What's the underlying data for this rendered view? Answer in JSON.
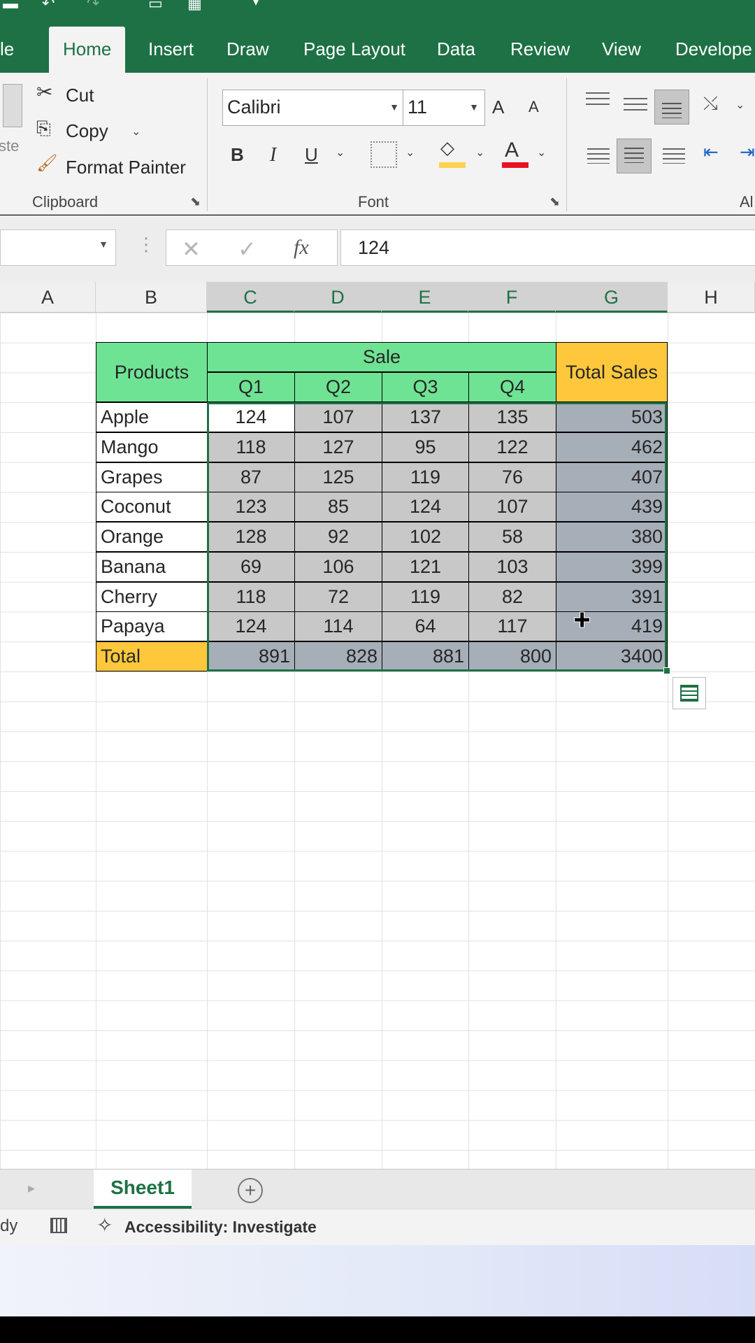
{
  "tabs": [
    "le",
    "Home",
    "Insert",
    "Draw",
    "Page Layout",
    "Data",
    "Review",
    "View",
    "Develope"
  ],
  "active_tab": "Home",
  "clipboard": {
    "paste_label": "ste",
    "cut_label": "Cut",
    "copy_label": "Copy",
    "format_painter_label": "Format Painter",
    "group_label": "Clipboard"
  },
  "font": {
    "font_name": "Calibri",
    "font_size": "11",
    "bold": "B",
    "italic": "I",
    "underline": "U",
    "font_color_glyph": "A",
    "grow_font_glyph": "A",
    "shrink_font_glyph": "A",
    "group_label": "Font",
    "fill_color": "#ffd34c",
    "font_color": "#e81123"
  },
  "alignment": {
    "group_label_partial": "Al"
  },
  "formula_bar": {
    "name_box": "",
    "fx": "fx",
    "value": "124"
  },
  "columns": [
    "A",
    "B",
    "C",
    "D",
    "E",
    "F",
    "G",
    "H"
  ],
  "selected_columns": [
    "C",
    "D",
    "E",
    "F",
    "G"
  ],
  "table": {
    "header_products": "Products",
    "header_sale": "Sale",
    "header_total_sales": "Total Sales",
    "quarters": [
      "Q1",
      "Q2",
      "Q3",
      "Q4"
    ],
    "rows": [
      {
        "product": "Apple",
        "q": [
          "124",
          "107",
          "137",
          "135"
        ],
        "total": "503"
      },
      {
        "product": "Mango",
        "q": [
          "118",
          "127",
          "95",
          "122"
        ],
        "total": "462"
      },
      {
        "product": "Grapes",
        "q": [
          "87",
          "125",
          "119",
          "76"
        ],
        "total": "407"
      },
      {
        "product": "Coconut",
        "q": [
          "123",
          "85",
          "124",
          "107"
        ],
        "total": "439"
      },
      {
        "product": "Orange",
        "q": [
          "128",
          "92",
          "102",
          "58"
        ],
        "total": "380"
      },
      {
        "product": "Banana",
        "q": [
          "69",
          "106",
          "121",
          "103"
        ],
        "total": "399"
      },
      {
        "product": "Cherry",
        "q": [
          "118",
          "72",
          "119",
          "82"
        ],
        "total": "391"
      },
      {
        "product": "Papaya",
        "q": [
          "124",
          "114",
          "64",
          "117"
        ],
        "total": "419"
      }
    ],
    "total_label": "Total",
    "totals": [
      "891",
      "828",
      "881",
      "800"
    ],
    "grand_total": "3400"
  },
  "sheet_tabs": {
    "active": "Sheet1",
    "add": "+"
  },
  "status_bar": {
    "ready_partial": "dy",
    "accessibility": "Accessibility: Investigate"
  },
  "colors": {
    "excel_green": "#1e7145",
    "header_green": "#6fe394",
    "header_gold": "#ffc83c",
    "selection_gray": "#c8c8c8",
    "total_col_gray": "#a6afb8"
  }
}
